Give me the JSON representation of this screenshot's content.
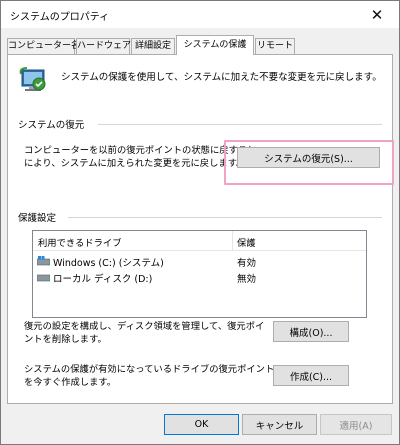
{
  "window": {
    "title": "システムのプロパティ",
    "close_symbol": "✕"
  },
  "tabs": [
    {
      "label": "コンピューター名"
    },
    {
      "label": "ハードウェア"
    },
    {
      "label": "詳細設定"
    },
    {
      "label": "システムの保護"
    },
    {
      "label": "リモート"
    }
  ],
  "intro": {
    "text": "システムの保護を使用して、システムに加えた不要な変更を元に戻します。"
  },
  "restore": {
    "heading": "システムの復元",
    "desc_line1": "コンピューターを以前の復元ポイントの状態に戻すこと",
    "desc_line2": "により、システムに加えられた変更を元に戻します。",
    "button": "システムの復元(S)..."
  },
  "protection": {
    "heading": "保護設定",
    "columns": [
      "利用できるドライブ",
      "保護"
    ],
    "drives": [
      {
        "name": "Windows (C:) (システム)",
        "status": "有効",
        "icon": "system-drive-icon"
      },
      {
        "name": "ローカル ディスク (D:)",
        "status": "無効",
        "icon": "drive-icon"
      }
    ],
    "configure_line1": "復元の設定を構成し、ディスク領域を管理して、復元ポイ",
    "configure_line2": "ントを削除します。",
    "configure_button": "構成(O)...",
    "create_line1": "システムの保護が有効になっているドライブの復元ポイント",
    "create_line2": "を今すぐ作成します。",
    "create_button": "作成(C)..."
  },
  "footer": {
    "ok": "OK",
    "cancel": "キャンセル",
    "apply": "適用(A)"
  },
  "colors": {
    "highlight": "#f0a3c4",
    "focus_border": "#0078d7"
  }
}
